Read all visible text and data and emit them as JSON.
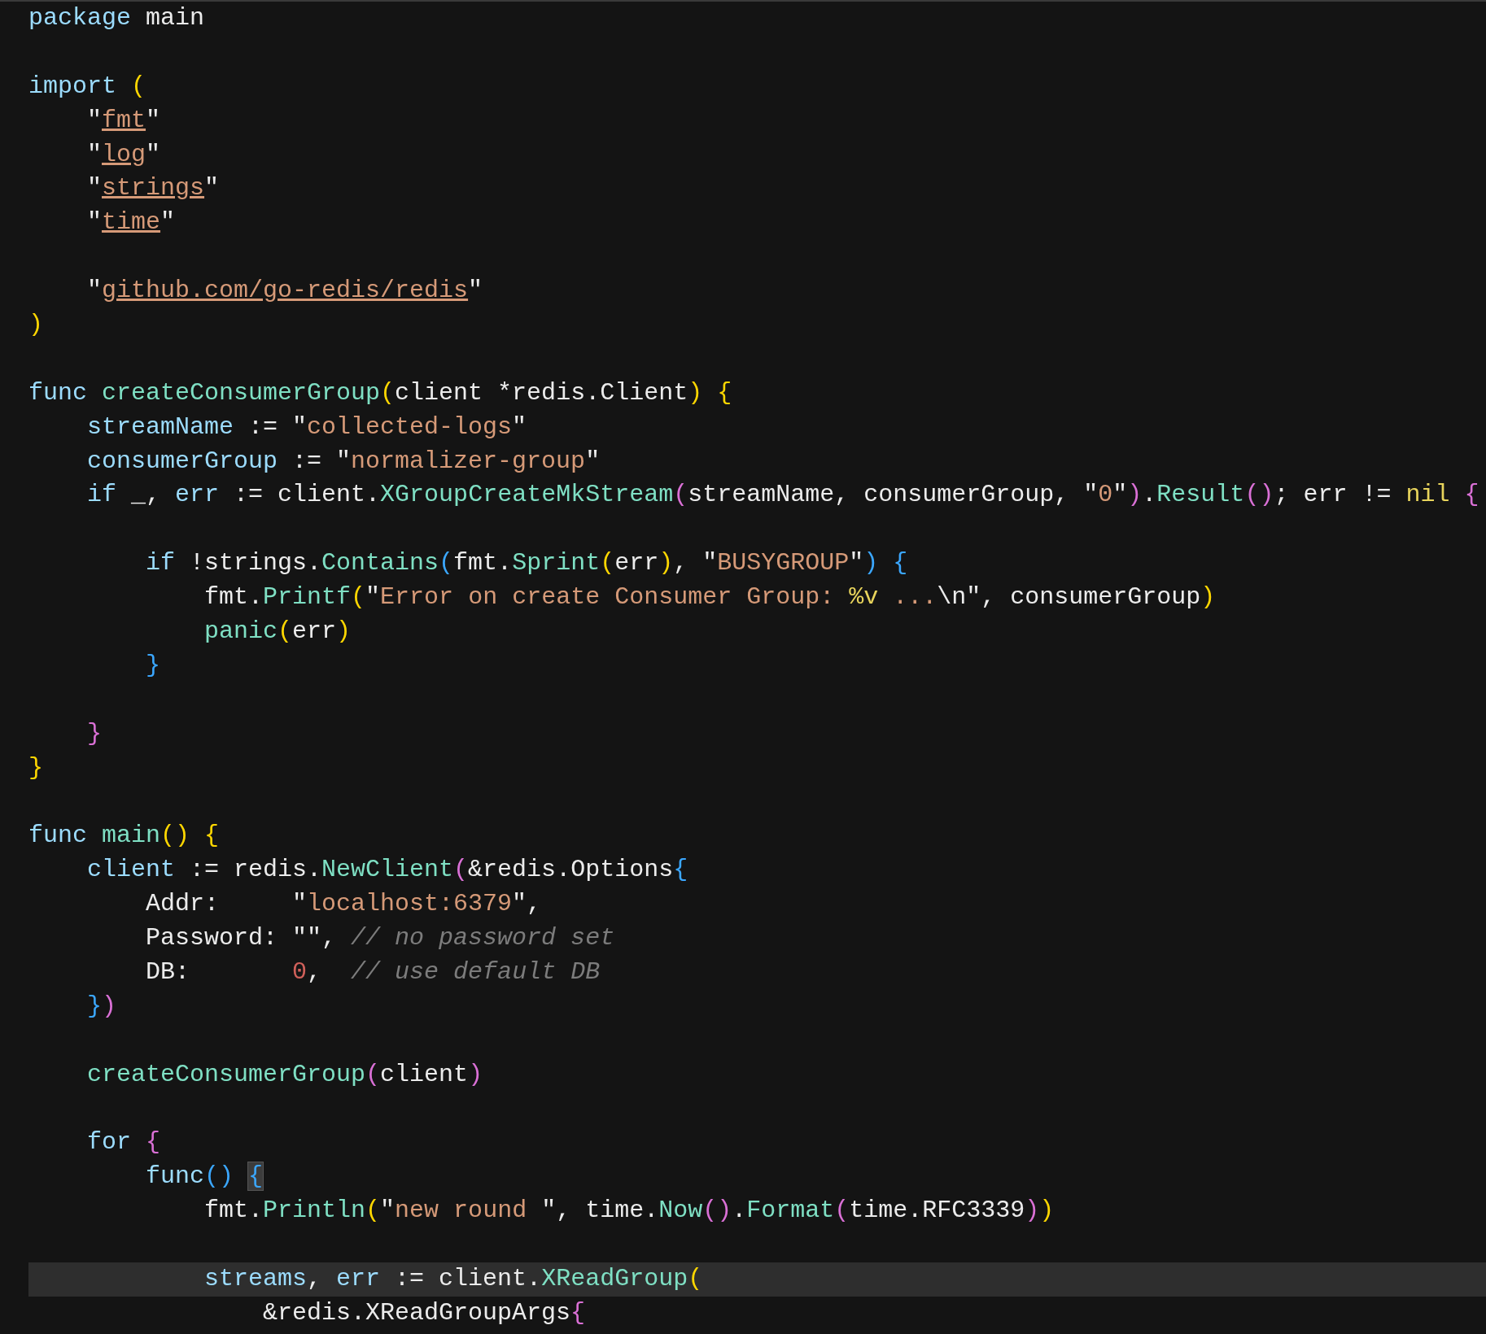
{
  "editor": {
    "lines": [
      {
        "current": false,
        "space_before": false,
        "tokens": [
          {
            "kind": "kw",
            "text": "package"
          },
          {
            "kind": "txt",
            "text": " main"
          }
        ]
      },
      {
        "current": false,
        "space_before": true,
        "tokens": [
          {
            "kind": "kw",
            "text": "import"
          },
          {
            "kind": "b1",
            "text": " ("
          }
        ]
      },
      {
        "current": false,
        "space_before": false,
        "tokens": [
          {
            "kind": "txt",
            "text": "    \""
          },
          {
            "kind": "path",
            "text": "fmt"
          },
          {
            "kind": "txt",
            "text": "\""
          }
        ]
      },
      {
        "current": false,
        "space_before": false,
        "tokens": [
          {
            "kind": "txt",
            "text": "    \""
          },
          {
            "kind": "path",
            "text": "log"
          },
          {
            "kind": "txt",
            "text": "\""
          }
        ]
      },
      {
        "current": false,
        "space_before": false,
        "tokens": [
          {
            "kind": "txt",
            "text": "    \""
          },
          {
            "kind": "path",
            "text": "strings"
          },
          {
            "kind": "txt",
            "text": "\""
          }
        ]
      },
      {
        "current": false,
        "space_before": false,
        "tokens": [
          {
            "kind": "txt",
            "text": "    \""
          },
          {
            "kind": "path",
            "text": "time"
          },
          {
            "kind": "txt",
            "text": "\""
          }
        ]
      },
      {
        "current": false,
        "space_before": true,
        "tokens": [
          {
            "kind": "txt",
            "text": "    \""
          },
          {
            "kind": "path",
            "text": "github.com/go-redis/redis"
          },
          {
            "kind": "txt",
            "text": "\""
          }
        ]
      },
      {
        "current": false,
        "space_before": false,
        "tokens": [
          {
            "kind": "b1",
            "text": ")"
          }
        ]
      },
      {
        "current": false,
        "space_before": true,
        "tokens": [
          {
            "kind": "kw",
            "text": "func"
          },
          {
            "kind": "fn",
            "text": " createConsumerGroup"
          },
          {
            "kind": "b1",
            "text": "("
          },
          {
            "kind": "txt",
            "text": "client *redis.Client"
          },
          {
            "kind": "b1",
            "text": ") {"
          }
        ]
      },
      {
        "current": false,
        "space_before": false,
        "tokens": [
          {
            "kind": "var",
            "text": "    streamName"
          },
          {
            "kind": "txt",
            "text": " := \""
          },
          {
            "kind": "str",
            "text": "collected-logs"
          },
          {
            "kind": "txt",
            "text": "\""
          }
        ]
      },
      {
        "current": false,
        "space_before": false,
        "tokens": [
          {
            "kind": "var",
            "text": "    consumerGroup"
          },
          {
            "kind": "txt",
            "text": " := \""
          },
          {
            "kind": "str",
            "text": "normalizer-group"
          },
          {
            "kind": "txt",
            "text": "\""
          }
        ]
      },
      {
        "current": false,
        "space_before": false,
        "tokens": [
          {
            "kind": "kw",
            "text": "    if"
          },
          {
            "kind": "txt",
            "text": " _, "
          },
          {
            "kind": "var",
            "text": "err"
          },
          {
            "kind": "txt",
            "text": " := client."
          },
          {
            "kind": "fn",
            "text": "XGroupCreateMkStream"
          },
          {
            "kind": "b2",
            "text": "("
          },
          {
            "kind": "txt",
            "text": "streamName, consumerGroup, \""
          },
          {
            "kind": "str",
            "text": "0"
          },
          {
            "kind": "txt",
            "text": "\""
          },
          {
            "kind": "b2",
            "text": ")"
          },
          {
            "kind": "txt",
            "text": "."
          },
          {
            "kind": "fn",
            "text": "Result"
          },
          {
            "kind": "b2",
            "text": "()"
          },
          {
            "kind": "txt",
            "text": "; err != "
          },
          {
            "kind": "const",
            "text": "nil"
          },
          {
            "kind": "b2",
            "text": " {"
          }
        ]
      },
      {
        "current": false,
        "space_before": true,
        "tokens": [
          {
            "kind": "kw",
            "text": "        if"
          },
          {
            "kind": "txt",
            "text": " !strings."
          },
          {
            "kind": "fn",
            "text": "Contains"
          },
          {
            "kind": "b3",
            "text": "("
          },
          {
            "kind": "txt",
            "text": "fmt."
          },
          {
            "kind": "fn",
            "text": "Sprint"
          },
          {
            "kind": "b1",
            "text": "("
          },
          {
            "kind": "txt",
            "text": "err"
          },
          {
            "kind": "b1",
            "text": ")"
          },
          {
            "kind": "txt",
            "text": ", \""
          },
          {
            "kind": "str",
            "text": "BUSYGROUP"
          },
          {
            "kind": "txt",
            "text": "\""
          },
          {
            "kind": "b3",
            "text": ") {"
          }
        ]
      },
      {
        "current": false,
        "space_before": false,
        "tokens": [
          {
            "kind": "txt",
            "text": "            fmt."
          },
          {
            "kind": "fn",
            "text": "Printf"
          },
          {
            "kind": "b1",
            "text": "("
          },
          {
            "kind": "txt",
            "text": "\""
          },
          {
            "kind": "str",
            "text": "Error on create Consumer Group: "
          },
          {
            "kind": "const",
            "text": "%v"
          },
          {
            "kind": "str",
            "text": " ..."
          },
          {
            "kind": "esc",
            "text": "\\n"
          },
          {
            "kind": "txt",
            "text": "\", consumerGroup"
          },
          {
            "kind": "b1",
            "text": ")"
          }
        ]
      },
      {
        "current": false,
        "space_before": false,
        "tokens": [
          {
            "kind": "fn",
            "text": "            panic"
          },
          {
            "kind": "b1",
            "text": "("
          },
          {
            "kind": "txt",
            "text": "err"
          },
          {
            "kind": "b1",
            "text": ")"
          }
        ]
      },
      {
        "current": false,
        "space_before": false,
        "tokens": [
          {
            "kind": "b3",
            "text": "        }"
          }
        ]
      },
      {
        "current": false,
        "space_before": true,
        "tokens": [
          {
            "kind": "b2",
            "text": "    }"
          }
        ]
      },
      {
        "current": false,
        "space_before": false,
        "tokens": [
          {
            "kind": "b1",
            "text": "}"
          }
        ]
      },
      {
        "current": false,
        "space_before": true,
        "tokens": [
          {
            "kind": "kw",
            "text": "func"
          },
          {
            "kind": "fn",
            "text": " main"
          },
          {
            "kind": "b1",
            "text": "() {"
          }
        ]
      },
      {
        "current": false,
        "space_before": false,
        "tokens": [
          {
            "kind": "var",
            "text": "    client"
          },
          {
            "kind": "txt",
            "text": " := redis."
          },
          {
            "kind": "fn",
            "text": "NewClient"
          },
          {
            "kind": "b2",
            "text": "("
          },
          {
            "kind": "txt",
            "text": "&redis.Options"
          },
          {
            "kind": "b3",
            "text": "{"
          }
        ]
      },
      {
        "current": false,
        "space_before": false,
        "tokens": [
          {
            "kind": "txt",
            "text": "        Addr:     \""
          },
          {
            "kind": "str",
            "text": "localhost:6379"
          },
          {
            "kind": "txt",
            "text": "\","
          }
        ]
      },
      {
        "current": false,
        "space_before": false,
        "tokens": [
          {
            "kind": "txt",
            "text": "        Password: \"\", "
          },
          {
            "kind": "cmt",
            "text": "// no password set"
          }
        ]
      },
      {
        "current": false,
        "space_before": false,
        "tokens": [
          {
            "kind": "txt",
            "text": "        DB:       "
          },
          {
            "kind": "num",
            "text": "0"
          },
          {
            "kind": "txt",
            "text": ",  "
          },
          {
            "kind": "cmt",
            "text": "// use default DB"
          }
        ]
      },
      {
        "current": false,
        "space_before": false,
        "tokens": [
          {
            "kind": "b3",
            "text": "    }"
          },
          {
            "kind": "b2",
            "text": ")"
          }
        ]
      },
      {
        "current": false,
        "space_before": true,
        "tokens": [
          {
            "kind": "fn",
            "text": "    createConsumerGroup"
          },
          {
            "kind": "b2",
            "text": "("
          },
          {
            "kind": "txt",
            "text": "client"
          },
          {
            "kind": "b2",
            "text": ")"
          }
        ]
      },
      {
        "current": false,
        "space_before": true,
        "tokens": [
          {
            "kind": "kw",
            "text": "    for"
          },
          {
            "kind": "b2",
            "text": " {"
          }
        ]
      },
      {
        "current": false,
        "space_before": false,
        "tokens": [
          {
            "kind": "kw",
            "text": "        func"
          },
          {
            "kind": "b3",
            "text": "() "
          },
          {
            "kind": "b3m",
            "text": "{"
          }
        ]
      },
      {
        "current": false,
        "space_before": false,
        "tokens": [
          {
            "kind": "txt",
            "text": "            fmt."
          },
          {
            "kind": "fn",
            "text": "Println"
          },
          {
            "kind": "b1",
            "text": "("
          },
          {
            "kind": "txt",
            "text": "\""
          },
          {
            "kind": "str",
            "text": "new round "
          },
          {
            "kind": "txt",
            "text": "\", time."
          },
          {
            "kind": "fn",
            "text": "Now"
          },
          {
            "kind": "b2",
            "text": "()"
          },
          {
            "kind": "txt",
            "text": "."
          },
          {
            "kind": "fn",
            "text": "Format"
          },
          {
            "kind": "b2",
            "text": "("
          },
          {
            "kind": "txt",
            "text": "time.RFC3339"
          },
          {
            "kind": "b2",
            "text": ")"
          },
          {
            "kind": "b1",
            "text": ")"
          }
        ]
      },
      {
        "current": true,
        "space_before": true,
        "tokens": [
          {
            "kind": "var",
            "text": "            streams"
          },
          {
            "kind": "txt",
            "text": ", "
          },
          {
            "kind": "var",
            "text": "err"
          },
          {
            "kind": "txt",
            "text": " := client."
          },
          {
            "kind": "fn",
            "text": "XReadGroup"
          },
          {
            "kind": "b1",
            "text": "("
          }
        ]
      },
      {
        "current": false,
        "space_before": false,
        "tokens": [
          {
            "kind": "txt",
            "text": "                &redis.XReadGroupArgs"
          },
          {
            "kind": "b2",
            "text": "{"
          }
        ]
      }
    ]
  }
}
